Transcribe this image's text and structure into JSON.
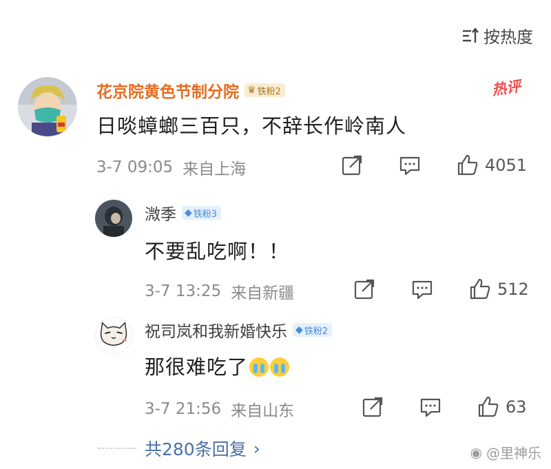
{
  "sort": {
    "label": "按热度"
  },
  "main_comment": {
    "username": "花京院黄色节制分院",
    "badge": "铁粉2",
    "hot_tag": "热评",
    "text": "日啖蟑螂三百只，不辞长作岭南人",
    "time": "3-7 09:05",
    "location": "来自上海",
    "likes": "4051"
  },
  "replies": [
    {
      "username": "溦季",
      "badge": "铁粉3",
      "text": "不要乱吃啊！！",
      "time": "3-7 13:25",
      "location": "来自新疆",
      "likes": "512"
    },
    {
      "username": "祝司岚和我新婚快乐",
      "badge": "铁粉2",
      "text": "那很难吃了",
      "time": "3-7 21:56",
      "location": "来自山东",
      "likes": "63"
    }
  ],
  "more_replies": {
    "label": "共280条回复",
    "arrow": "›"
  },
  "watermark": "@里神乐",
  "colors": {
    "username_main": "#e86b1f",
    "link": "#4a6fa6",
    "hot": "#f04f4f",
    "badge_gold": "#f8ecd2",
    "badge_blue": "#e5f0fb"
  }
}
